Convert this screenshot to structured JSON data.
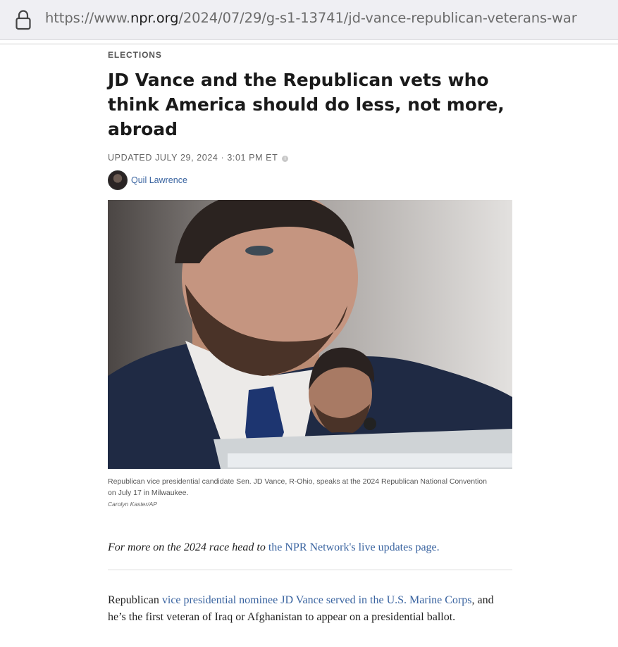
{
  "browser": {
    "url_scheme": "https://www.",
    "url_domain": "npr.org",
    "url_path": "/2024/07/29/g-s1-13741/jd-vance-republican-veterans-war"
  },
  "article": {
    "section": "ELECTIONS",
    "headline": "JD Vance and the Republican vets who think America should do less, not more, abroad",
    "dateline": "UPDATED JULY 29, 2024 · 3:01 PM ET",
    "author": "Quil Lawrence",
    "caption": "Republican vice presidential candidate Sen. JD Vance, R-Ohio, speaks at the 2024 Republican National Convention on July 17 in Milwaukee.",
    "credit": "Carolyn Kaster/AP",
    "promo_text": "For more on the 2024 race head to ",
    "promo_link": "the NPR Network's live updates page.",
    "body_start": "Republican ",
    "body_link": "vice presidential nominee JD Vance served in the U.S. Marine Corps",
    "body_rest": ", and he’s the first veteran of Iraq or Afghanistan to appear on a presidential ballot."
  },
  "icons": {
    "lock": "lock-icon",
    "info": "info-icon"
  },
  "colors": {
    "link": "#3a64a0",
    "urlbar_bg": "#efeff3"
  }
}
